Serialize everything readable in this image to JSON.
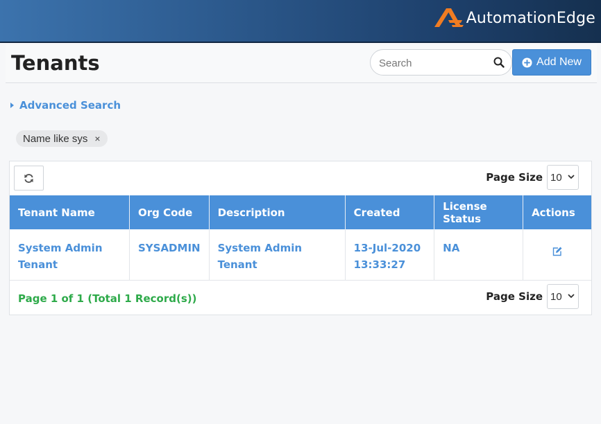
{
  "brand": {
    "name": "AutomationEdge",
    "accent": "#f07c22"
  },
  "page": {
    "title": "Tenants"
  },
  "search": {
    "placeholder": "Search",
    "value": ""
  },
  "toolbar": {
    "add_label": "Add New"
  },
  "advanced_search": {
    "label": "Advanced Search"
  },
  "filters": [
    {
      "label": "Name like sys",
      "close": "×"
    }
  ],
  "table": {
    "page_size_label": "Page Size",
    "page_size_value": "10",
    "columns": [
      "Tenant Name",
      "Org Code",
      "Description",
      "Created",
      "License Status",
      "Actions"
    ],
    "rows": [
      {
        "tenant_name": "System Admin Tenant",
        "org_code": "SYSADMIN",
        "description": "System Admin Tenant",
        "created": "13-Jul-2020 13:33:27",
        "license_status": "NA",
        "action_icon": "edit-icon"
      }
    ]
  },
  "pagination": {
    "summary": "Page 1 of 1 (Total 1 Record(s))"
  },
  "colors": {
    "primary": "#4a90d9",
    "success": "#2eaa4a",
    "header_dark": "#15304f"
  }
}
